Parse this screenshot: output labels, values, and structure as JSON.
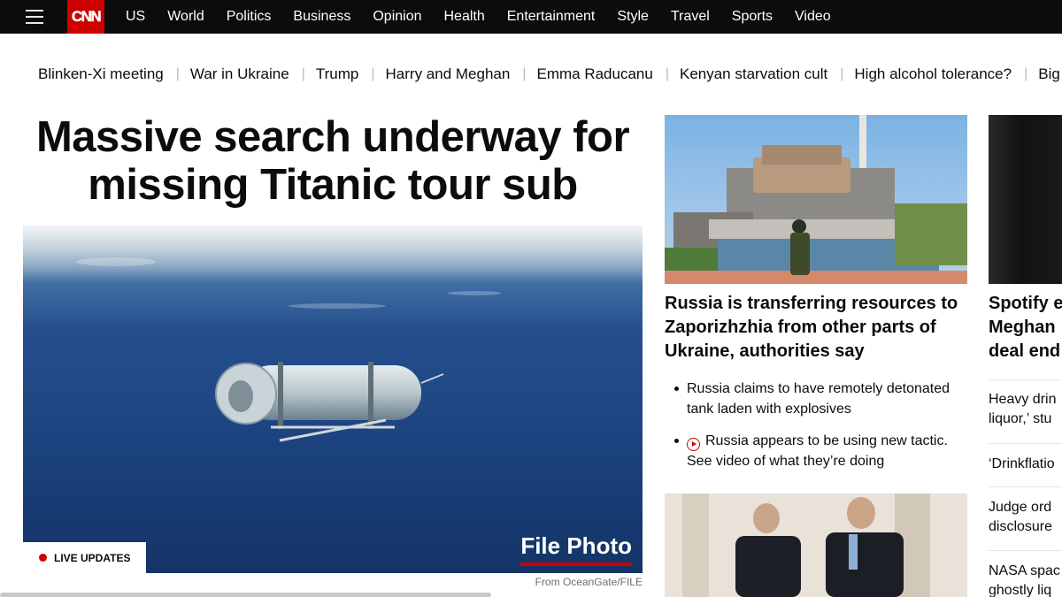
{
  "brand": {
    "logo_text": "CNN",
    "color": "#cc0000"
  },
  "nav": {
    "items": [
      "US",
      "World",
      "Politics",
      "Business",
      "Opinion",
      "Health",
      "Entertainment",
      "Style",
      "Travel",
      "Sports",
      "Video"
    ]
  },
  "trending": {
    "items": [
      "Blinken-Xi meeting",
      "War in Ukraine",
      "Trump",
      "Harry and Meghan",
      "Emma Raducanu",
      "Kenyan starvation cult",
      "High alcohol tolerance?",
      "Big Po"
    ]
  },
  "lead": {
    "headline": "Massive search underway for missing Titanic tour sub",
    "image_caption": "File Photo",
    "live_label": "LIVE UPDATES",
    "credit": "From OceanGate/FILE"
  },
  "story2": {
    "headline": "Russia is transferring resources to Zaporizhzhia from other parts of Ukraine, authorities say",
    "bullets": [
      {
        "text": "Russia claims to have remotely detonated tank laden with explosives",
        "icon": ""
      },
      {
        "text": "Russia appears to be using new tactic. See video of what they’re doing",
        "icon": "play-icon"
      }
    ]
  },
  "right_column": {
    "headline": "Spotify e\nMeghan\ndeal end",
    "items": [
      "Heavy drin\nliquor,’ stu",
      "‘Drinkflatio",
      "Judge ord\ndisclosure",
      "NASA spac\nghostly liq"
    ]
  }
}
